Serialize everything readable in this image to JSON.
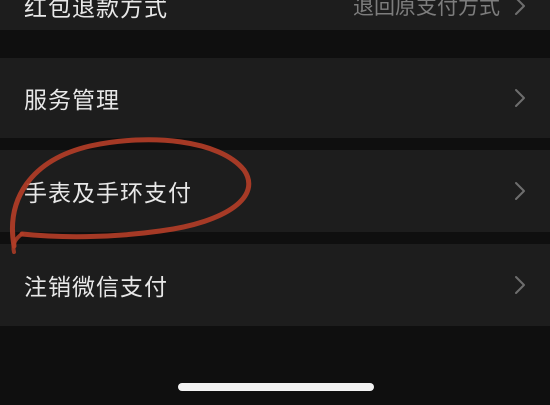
{
  "settings": {
    "items": [
      {
        "label": "红包退款方式",
        "value": "退回原支付方式"
      },
      {
        "label": "服务管理",
        "value": ""
      },
      {
        "label": "手表及手环支付",
        "value": ""
      },
      {
        "label": "注销微信支付",
        "value": ""
      }
    ]
  },
  "annotation": {
    "color": "#b8402a",
    "shape": "hand-drawn-circle"
  },
  "icons": {
    "chevron": "chevron-right-icon"
  }
}
